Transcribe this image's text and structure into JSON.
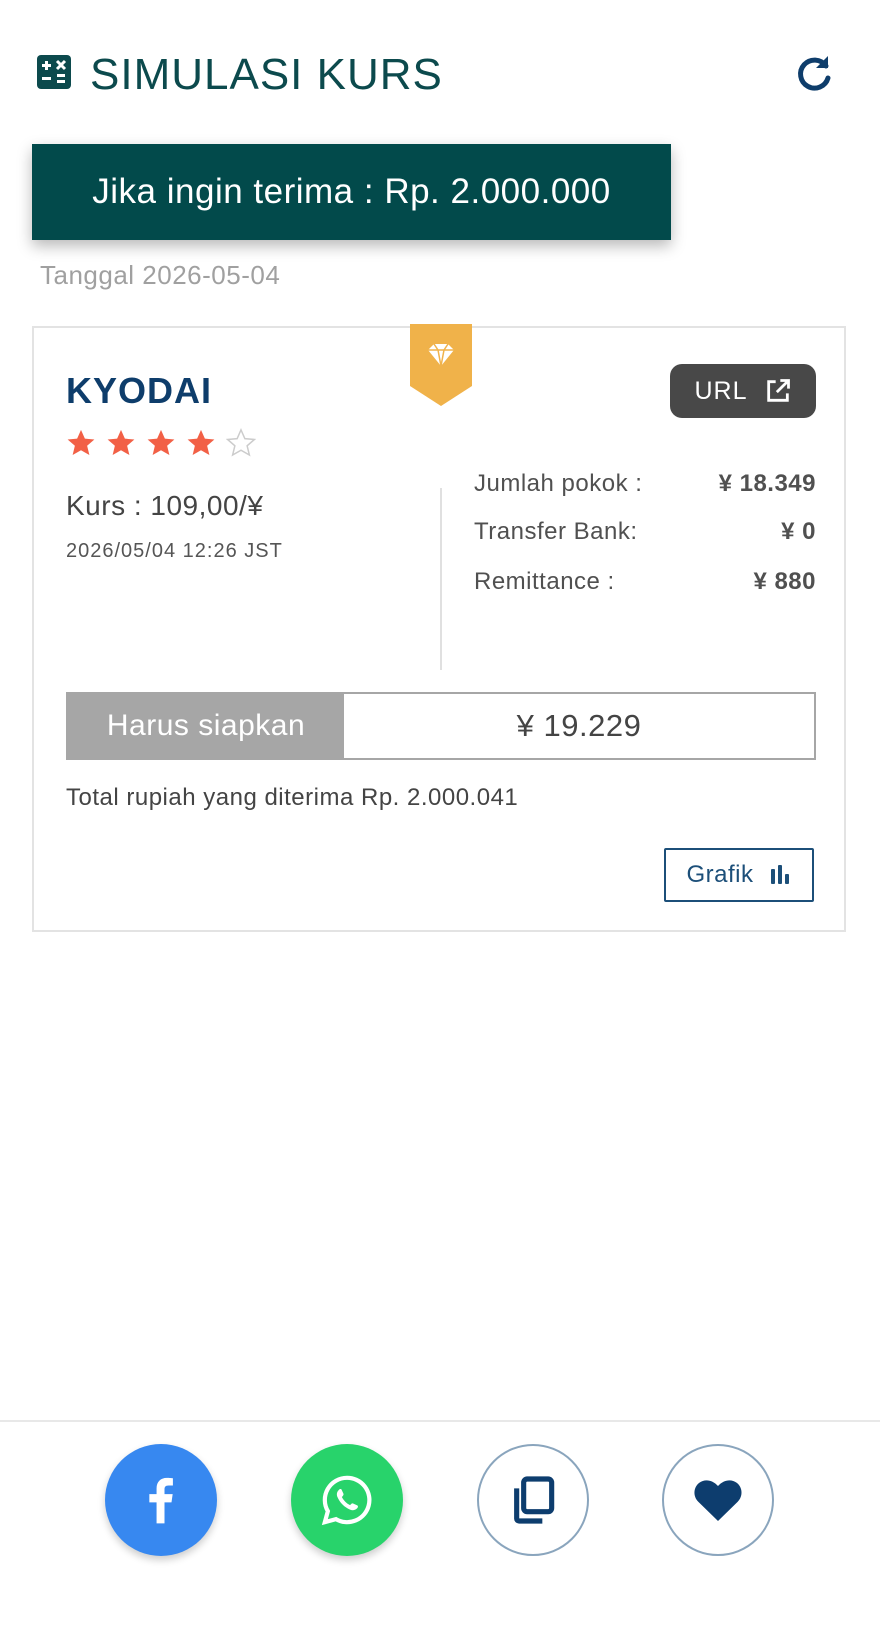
{
  "header": {
    "title": "SIMULASI KURS"
  },
  "banner": {
    "text": "Jika ingin terima : Rp. 2.000.000"
  },
  "date": "Tanggal 2026-05-04",
  "card": {
    "bank_name": "KYODAI",
    "rating": 4,
    "rating_max": 5,
    "url_label": "URL",
    "kurs": "Kurs : 109,00/¥",
    "kurs_time": "2026/05/04 12:26 JST",
    "fees": [
      {
        "label": "Jumlah pokok :",
        "value": "¥ 18.349"
      },
      {
        "label": "Transfer Bank:",
        "value": "¥ 0"
      },
      {
        "label": "Remittance :",
        "value": "¥ 880"
      }
    ],
    "prepare_label": "Harus siapkan",
    "prepare_value": "¥ 19.229",
    "total": "Total rupiah yang diterima Rp. 2.000.041",
    "grafik_label": "Grafik"
  },
  "colors": {
    "primary": "#024a4b",
    "title": "#0c4a4d",
    "bank": "#0e3d6b",
    "star": "#f26046",
    "ribbon": "#f0b24a",
    "facebook": "#3788f0",
    "whatsapp": "#28d36b",
    "heart": "#0d3d6e"
  },
  "share": {
    "icons": [
      "facebook-icon",
      "whatsapp-icon",
      "copy-icon",
      "heart-icon"
    ]
  }
}
